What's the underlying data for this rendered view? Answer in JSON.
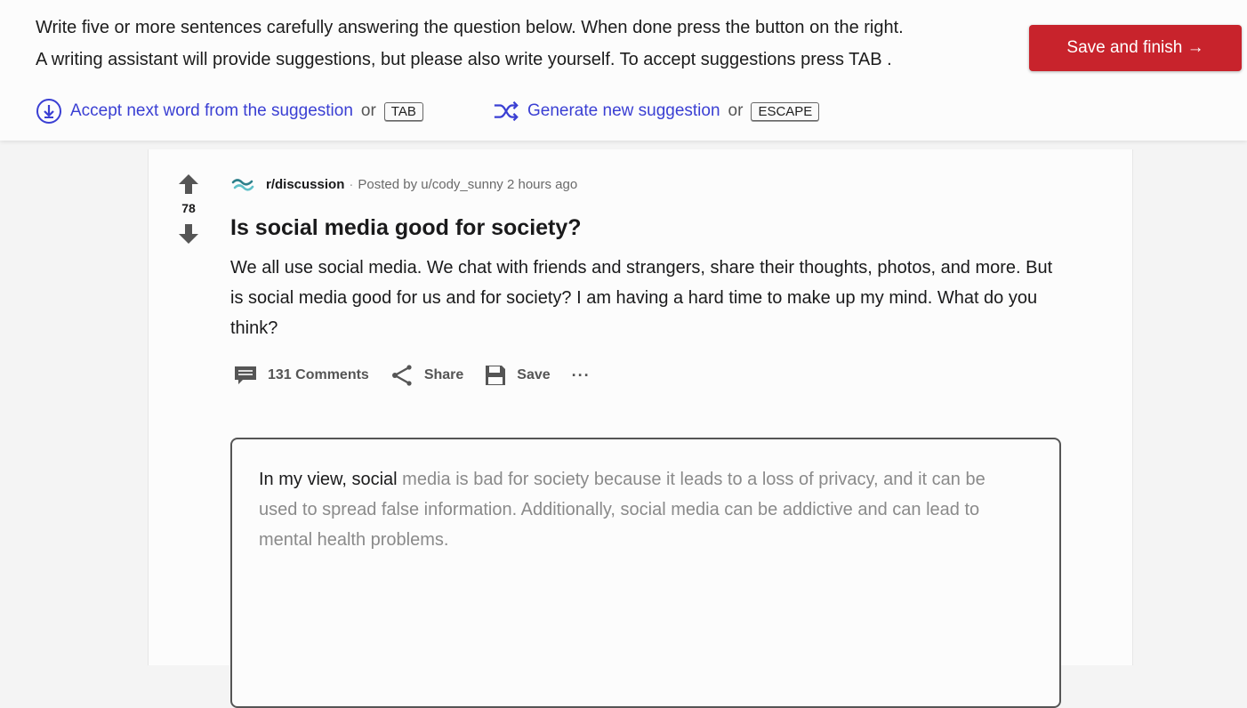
{
  "instructions": {
    "line1": "Write five or more sentences carefully answering the question below. When done press the button on the right.",
    "line2": "A writing assistant will provide suggestions, but please also write yourself. To accept suggestions press TAB ."
  },
  "finish_button": "Save and finish →",
  "hints": {
    "accept_label": "Accept next word from the suggestion",
    "accept_key": "TAB",
    "generate_label": "Generate new suggestion",
    "generate_key": "ESCAPE",
    "or": "or"
  },
  "post": {
    "subreddit": "r/discussion",
    "separator": "·",
    "posted_by": "Posted by u/cody_sunny 2 hours ago",
    "score": "78",
    "title": "Is social media good for society?",
    "body": "We all use social media. We chat with friends and strangers, share their thoughts, photos, and more. But is social media good for us and for society? I am having a hard time to make up my mind. What do you think?",
    "actions": {
      "comments": "131 Comments",
      "share": "Share",
      "save": "Save",
      "more": "···"
    }
  },
  "editor": {
    "typed": "In my view, social",
    "suggestion": " media is bad for society because it leads to a loss of privacy, and it can be used to spread false information. Additionally, social media can be addictive and can lead to mental health problems."
  },
  "colors": {
    "accent_red": "#c8232c",
    "link_blue": "#3a3fd3",
    "suggestion_gray": "#8a8a8a"
  },
  "icons": {
    "accept": "download-circle-icon",
    "generate": "shuffle-icon",
    "upvote": "arrow-up-icon",
    "downvote": "arrow-down-icon",
    "subreddit": "subreddit-wave-icon",
    "comments": "comment-bubble-icon",
    "share": "share-icon",
    "save": "floppy-disk-icon"
  }
}
